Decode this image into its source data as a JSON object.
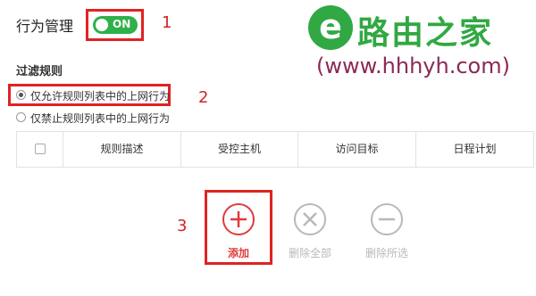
{
  "header": {
    "behavior_label": "行为管理",
    "toggle_label": "ON",
    "callout_1": "1"
  },
  "watermark": {
    "brand": "路由之家",
    "url": "(www.hhhyh.com)"
  },
  "filter": {
    "title": "过滤规则",
    "options": [
      {
        "label": "仅允许规则列表中的上网行为",
        "checked": true
      },
      {
        "label": "仅禁止规则列表中的上网行为",
        "checked": false
      }
    ],
    "callout_2": "2"
  },
  "table": {
    "columns": [
      "规则描述",
      "受控主机",
      "访问目标",
      "日程计划"
    ]
  },
  "actions": {
    "callout_3": "3",
    "add_label": "添加",
    "delete_all_label": "删除全部",
    "delete_selected_label": "删除所选"
  },
  "colors": {
    "accent_red": "#e12222",
    "toggle_green": "#2eb14a",
    "disabled_gray": "#b8b8b8",
    "brand_green": "#31a843",
    "url_purple": "#8a2a55"
  }
}
